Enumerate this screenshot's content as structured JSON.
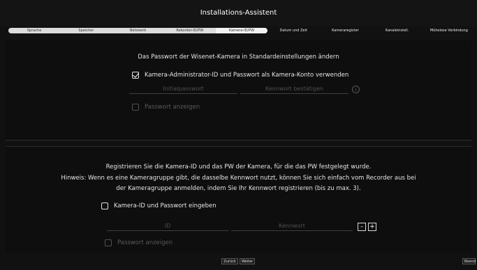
{
  "header": {
    "title": "Installations-Assistent"
  },
  "steps": [
    {
      "label": "Sprache",
      "state": "done"
    },
    {
      "label": "Speicher",
      "state": "done"
    },
    {
      "label": "Netzwerk",
      "state": "done"
    },
    {
      "label": "Rekorder-ID/PW",
      "state": "done"
    },
    {
      "label": "Kamera-ID/PW",
      "state": "active"
    },
    {
      "label": "Datum und Zeit",
      "state": "pending"
    },
    {
      "label": "Kameraregister",
      "state": "pending"
    },
    {
      "label": "Kanaleinstell.",
      "state": "pending"
    },
    {
      "label": "Mühelose Verbindung",
      "state": "pending"
    }
  ],
  "section_default": {
    "heading": "Das Passwort der Wisenet-Kamera in Standardeinstellungen ändern",
    "use_admin_checkbox": {
      "label": "Kamera-Administrator-ID und Passwort als Kamera-Konto verwenden",
      "checked": true
    },
    "initial_password_placeholder": "Initialpasswort",
    "confirm_password_placeholder": "Kennwort bestätigen",
    "info_glyph": "i",
    "show_password_label": "Passwort anzeigen"
  },
  "section_register": {
    "line1": "Registrieren Sie die Kamera-ID und das PW der Kamera, für die das PW festgelegt wurde.",
    "line2": "Hinweis: Wenn es eine Kameragruppe gibt, die dasselbe Kennwort nutzt, können Sie sich einfach vom Recorder aus bei",
    "line3": "der Kameragruppe anmelden, indem Sie Ihr Kennwort registrieren (bis zu max. 3).",
    "enter_checkbox": {
      "label": "Kamera-ID und Passwort eingeben",
      "checked": false
    },
    "id_placeholder": "ID",
    "password_placeholder": "Kennwort",
    "minus_label": "-",
    "plus_label": "+",
    "show_password_label": "Passwort anzeigen"
  },
  "footer": {
    "back_label": "Zurück",
    "next_label": "Weiter",
    "exit_label": "Beend"
  },
  "colors": {
    "background": "#111111",
    "step_done": "#dcdcdc",
    "text": "#e6e6e6",
    "disabled": "#505050"
  }
}
